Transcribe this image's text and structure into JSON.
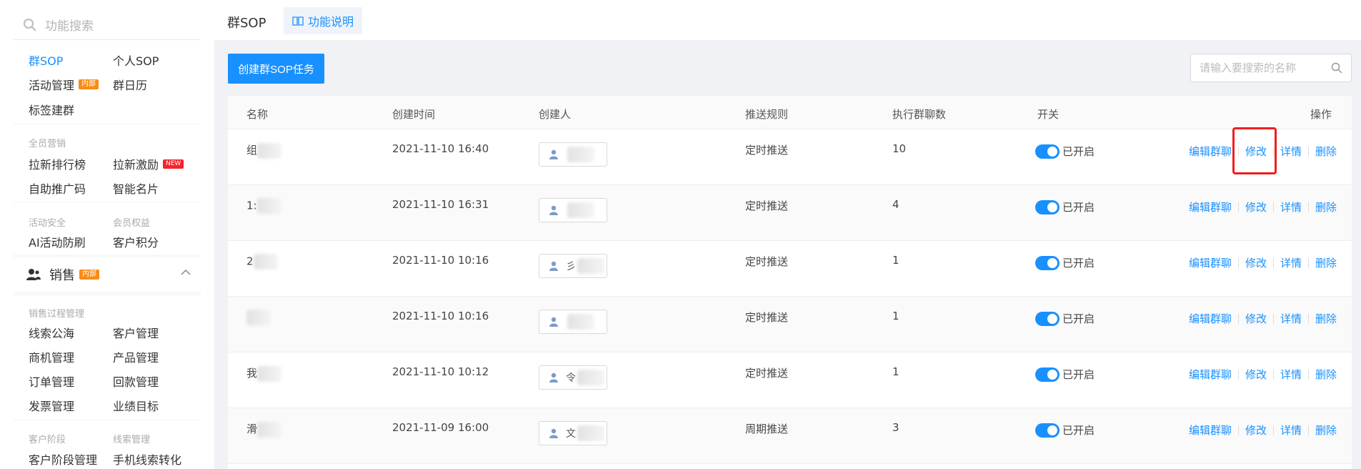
{
  "sidebar": {
    "search_placeholder": "功能搜索",
    "top_items": [
      "群SOP",
      "个人SOP",
      "活动管理",
      "群日历",
      "标签建群"
    ],
    "tag_neibu": "内部",
    "tag_new": "NEW",
    "group_quanyuan": "全员营销",
    "quanyuan_items": [
      "拉新排行榜",
      "拉新激励",
      "自助推广码",
      "智能名片"
    ],
    "group_huodong_anquan": "活动安全",
    "group_huiyuan_quanyi": "会员权益",
    "anquan_items": [
      "AI活动防刷",
      "客户积分"
    ],
    "sales_label": "销售",
    "group_xiaoshou_guocheng": "销售过程管理",
    "sales_items": [
      "线索公海",
      "客户管理",
      "商机管理",
      "产品管理",
      "订单管理",
      "回款管理",
      "发票管理",
      "业绩目标"
    ],
    "group_kehu_jieduan": "客户阶段",
    "group_xiansuo_guanli": "线索管理",
    "bottom_items": [
      "客户阶段管理",
      "手机线索转化"
    ]
  },
  "topbar": {
    "title": "群SOP",
    "help_tab": "功能说明"
  },
  "toolbar": {
    "create_label": "创建群SOP任务",
    "search_placeholder": "请输入要搜索的名称"
  },
  "table": {
    "headers": [
      "名称",
      "创建时间",
      "创建人",
      "推送规则",
      "执行群聊数",
      "开关",
      "操作"
    ],
    "rows": [
      {
        "name": "组",
        "time": "2021-11-10 16:40",
        "creator": "",
        "rule": "定时推送",
        "count": "10",
        "status": "已开启"
      },
      {
        "name": "1:",
        "time": "2021-11-10 16:31",
        "creator": "",
        "rule": "定时推送",
        "count": "4",
        "status": "已开启"
      },
      {
        "name": "2",
        "time": "2021-11-10 10:16",
        "creator": "彡",
        "rule": "定时推送",
        "count": "1",
        "status": "已开启"
      },
      {
        "name": "",
        "time": "2021-11-10 10:16",
        "creator": "",
        "rule": "定时推送",
        "count": "1",
        "status": "已开启"
      },
      {
        "name": "我",
        "time": "2021-11-10 10:12",
        "creator": "令",
        "rule": "定时推送",
        "count": "1",
        "status": "已开启"
      },
      {
        "name": "滑",
        "time": "2021-11-09 16:00",
        "creator": "文",
        "rule": "周期推送",
        "count": "3",
        "status": "已开启"
      }
    ],
    "ops": [
      "编辑群聊",
      "修改",
      "详情",
      "删除"
    ]
  }
}
